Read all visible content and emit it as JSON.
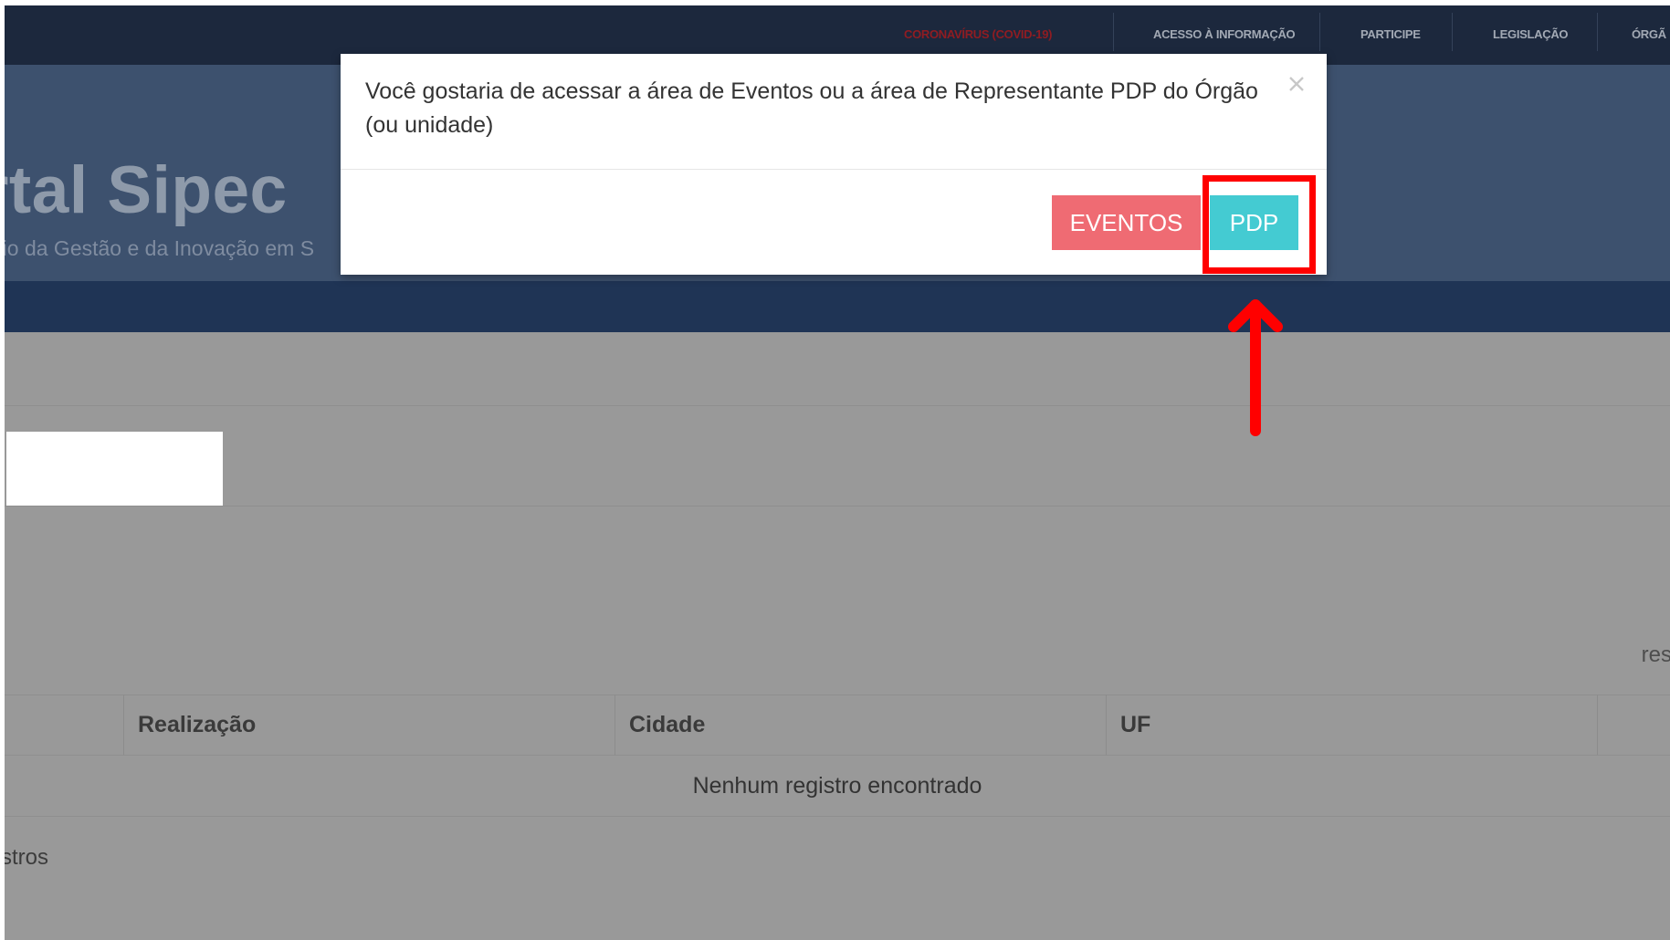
{
  "top_bar": {
    "links": [
      {
        "label": "CORONAVÍRUS (COVID-19)",
        "color": "#8f1c22"
      },
      {
        "label": "ACESSO À INFORMAÇÃO"
      },
      {
        "label": "PARTICIPE"
      },
      {
        "label": "LEGISLAÇÃO"
      },
      {
        "label": "ÓRGÃ"
      }
    ]
  },
  "header": {
    "title": "rtal Sipec",
    "subtitle": "rio da Gestão e da Inovação em S"
  },
  "page": {
    "results_label": "res",
    "records_label": "stros"
  },
  "table": {
    "columns": [
      "",
      "Realização",
      "Cidade",
      "UF",
      ""
    ],
    "empty_message": "Nenhum registro encontrado"
  },
  "modal": {
    "message": "Você gostaria de acessar a área de Eventos ou a área de Representante PDP do Órgão (ou unidade)",
    "close_icon": "close-icon",
    "buttons": {
      "eventos": "EVENTOS",
      "pdp": "PDP"
    }
  },
  "annotation": {
    "highlight_target": "PDP",
    "color": "#ff0000",
    "icon": "arrow-up-icon"
  },
  "colors": {
    "eventos_button": "#ef6b73",
    "pdp_button": "#44cbd2",
    "top_bar": "#1c283d",
    "overlay": "#999999"
  }
}
